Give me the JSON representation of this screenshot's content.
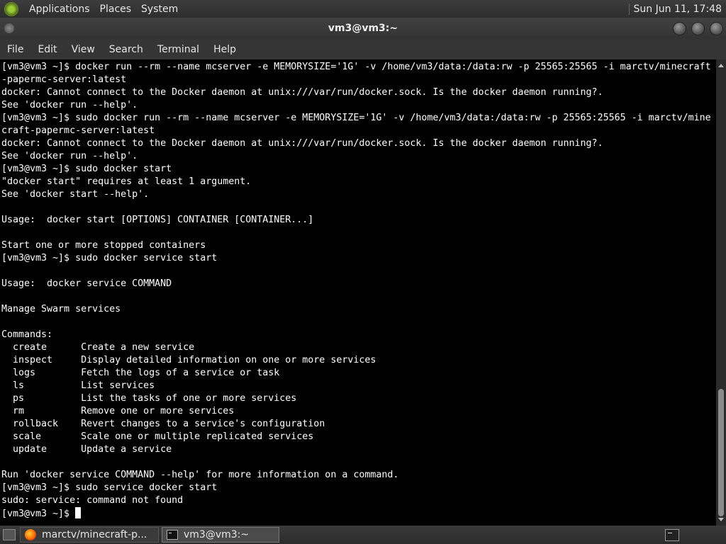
{
  "top_panel": {
    "menus": [
      "Applications",
      "Places",
      "System"
    ],
    "clock": "Sun Jun 11, 17:48"
  },
  "window": {
    "title": "vm3@vm3:~"
  },
  "menubar": {
    "items": [
      "File",
      "Edit",
      "View",
      "Search",
      "Terminal",
      "Help"
    ]
  },
  "terminal": {
    "lines": [
      "[vm3@vm3 ~]$ docker run --rm --name mcserver -e MEMORYSIZE='1G' -v /home/vm3/data:/data:rw -p 25565:25565 -i marctv/minecraft",
      "-papermc-server:latest",
      "docker: Cannot connect to the Docker daemon at unix:///var/run/docker.sock. Is the docker daemon running?.",
      "See 'docker run --help'.",
      "[vm3@vm3 ~]$ sudo docker run --rm --name mcserver -e MEMORYSIZE='1G' -v /home/vm3/data:/data:rw -p 25565:25565 -i marctv/mine",
      "craft-papermc-server:latest",
      "docker: Cannot connect to the Docker daemon at unix:///var/run/docker.sock. Is the docker daemon running?.",
      "See 'docker run --help'.",
      "[vm3@vm3 ~]$ sudo docker start",
      "\"docker start\" requires at least 1 argument.",
      "See 'docker start --help'.",
      "",
      "Usage:  docker start [OPTIONS] CONTAINER [CONTAINER...]",
      "",
      "Start one or more stopped containers",
      "[vm3@vm3 ~]$ sudo docker service start",
      "",
      "Usage:  docker service COMMAND",
      "",
      "Manage Swarm services",
      "",
      "Commands:",
      "  create      Create a new service",
      "  inspect     Display detailed information on one or more services",
      "  logs        Fetch the logs of a service or task",
      "  ls          List services",
      "  ps          List the tasks of one or more services",
      "  rm          Remove one or more services",
      "  rollback    Revert changes to a service's configuration",
      "  scale       Scale one or multiple replicated services",
      "  update      Update a service",
      "",
      "Run 'docker service COMMAND --help' for more information on a command.",
      "[vm3@vm3 ~]$ sudo service docker start",
      "sudo: service: command not found"
    ],
    "prompt": "[vm3@vm3 ~]$ "
  },
  "taskbar": {
    "tasks": [
      {
        "label": "marctv/minecraft-p...",
        "icon": "firefox-icon"
      },
      {
        "label": "vm3@vm3:~",
        "icon": "terminal-icon"
      }
    ]
  }
}
